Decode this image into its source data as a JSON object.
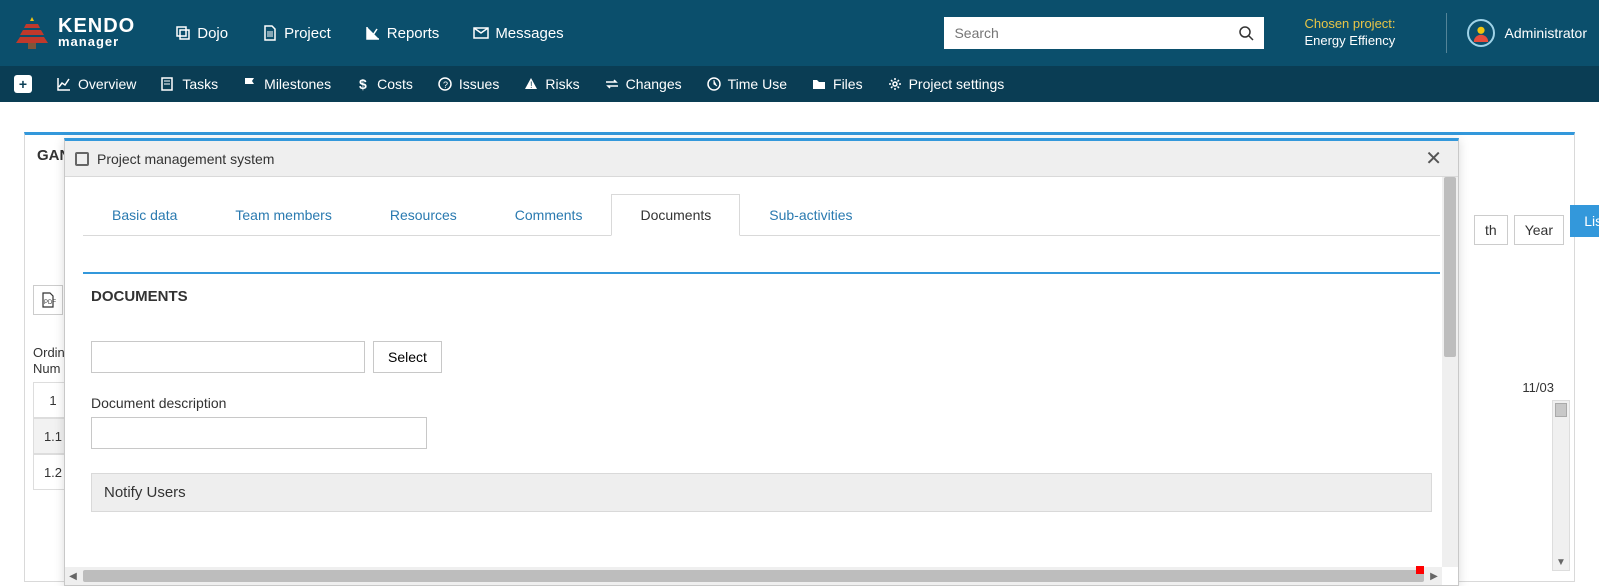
{
  "brand": {
    "line1": "KENDO",
    "line2": "manager"
  },
  "main_nav": {
    "dojo": "Dojo",
    "project": "Project",
    "reports": "Reports",
    "messages": "Messages"
  },
  "search": {
    "placeholder": "Search"
  },
  "chosen_project": {
    "label": "Chosen project:",
    "value": "Energy Effiency"
  },
  "user": {
    "name": "Administrator"
  },
  "sub_nav": {
    "overview": "Overview",
    "tasks": "Tasks",
    "milestones": "Milestones",
    "costs": "Costs",
    "issues": "Issues",
    "risks": "Risks",
    "changes": "Changes",
    "time_use": "Time Use",
    "files": "Files",
    "project_settings": "Project settings"
  },
  "panel": {
    "title_prefix": "GAN"
  },
  "background": {
    "list_view": "List View",
    "zoom_year": "Year",
    "zoom_th": "th",
    "col_header_line1": "Ordin",
    "col_header_line2": "Num",
    "rows": [
      "1",
      "1.1",
      "1.2"
    ],
    "timeline_date": "11/03"
  },
  "modal": {
    "title": "Project management system",
    "tabs": {
      "basic_data": "Basic data",
      "team_members": "Team members",
      "resources": "Resources",
      "comments": "Comments",
      "documents": "Documents",
      "sub_activities": "Sub-activities"
    },
    "documents": {
      "heading": "DOCUMENTS",
      "select_button": "Select",
      "description_label": "Document description",
      "notify_users": "Notify Users"
    }
  }
}
